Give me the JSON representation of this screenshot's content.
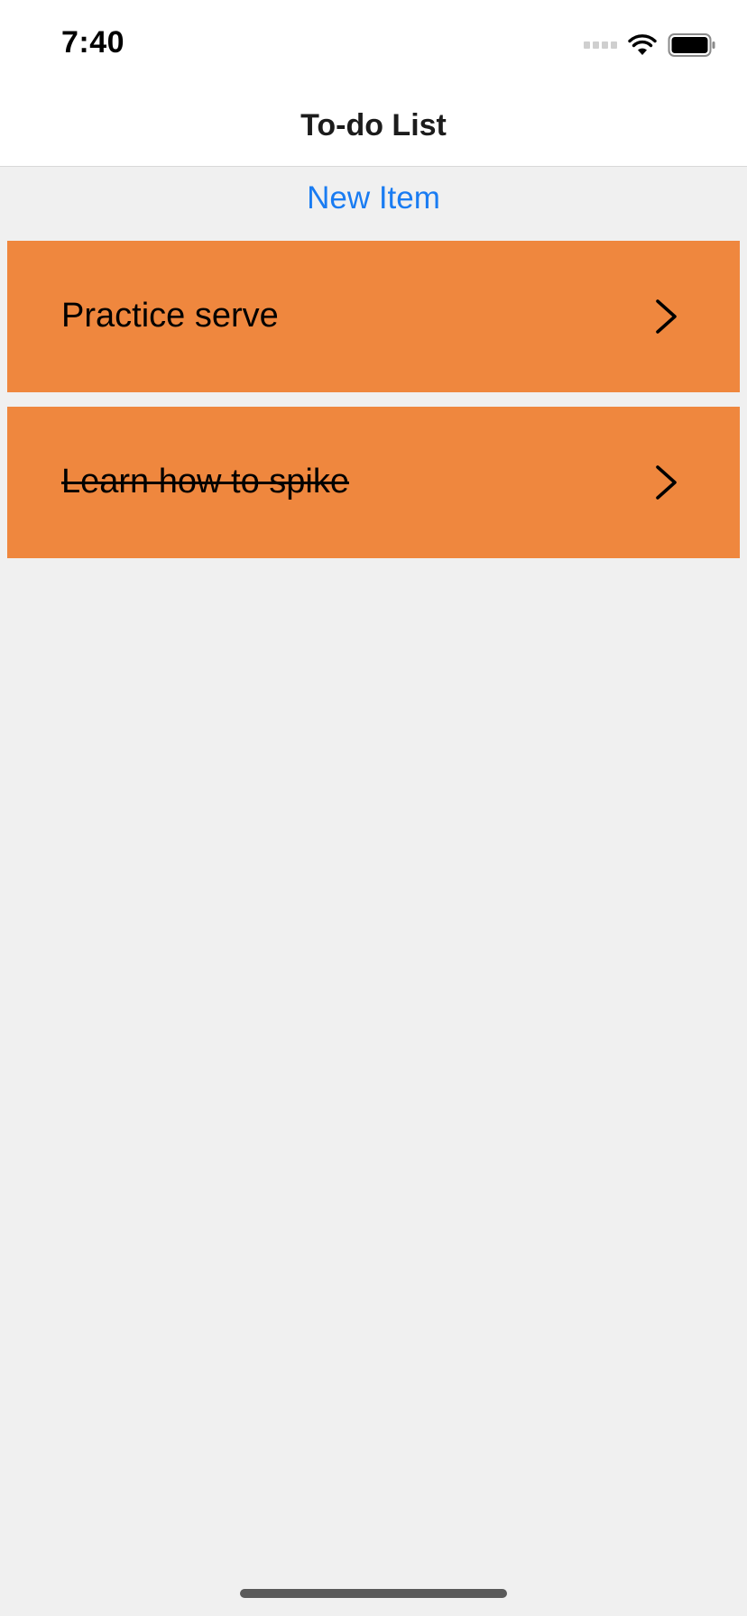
{
  "status_bar": {
    "time": "7:40",
    "icons": [
      "signal-dots-icon",
      "wifi-icon",
      "battery-icon"
    ]
  },
  "nav": {
    "title": "To-do List"
  },
  "actions": {
    "new_item_label": "New Item"
  },
  "todos": [
    {
      "label": "Practice serve",
      "completed": false
    },
    {
      "label": "Learn how to spike",
      "completed": true
    }
  ],
  "colors": {
    "row_background": "#ef873e",
    "accent": "#1a7cf2",
    "page_background": "#f0f0f0"
  }
}
